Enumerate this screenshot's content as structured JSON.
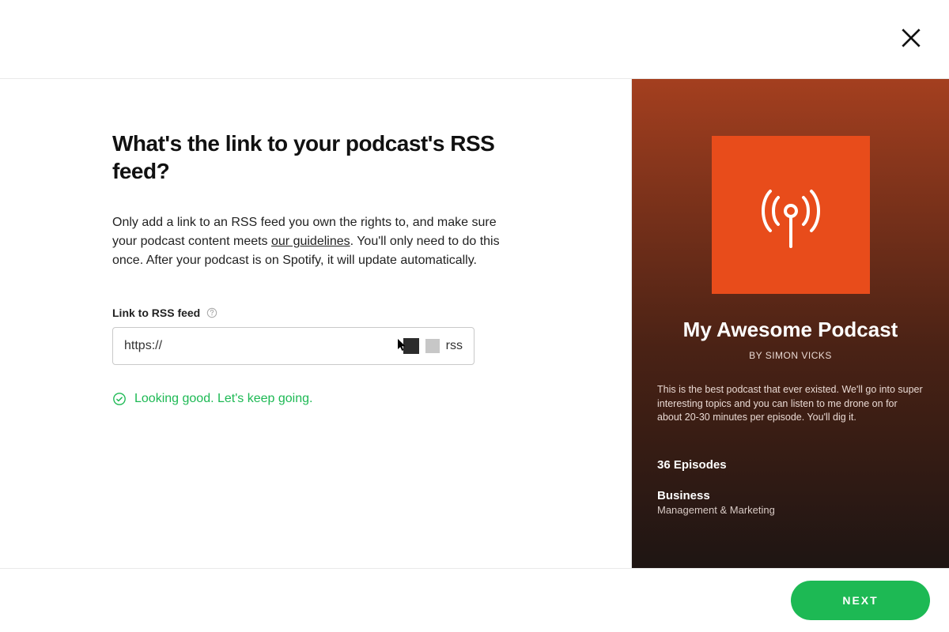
{
  "heading": "What's the link to your podcast's RSS feed?",
  "description": {
    "pre": "Only add a link to an RSS feed you own the rights to, and make sure your podcast content meets ",
    "link": "our guidelines",
    "post": ". You'll only need to do this once. After your podcast is on Spotify, it will update automatically."
  },
  "field": {
    "label": "Link to RSS feed",
    "prefix_value": "https://",
    "suffix_value": "rss"
  },
  "validation": {
    "text": "Looking good. Let's keep going."
  },
  "preview": {
    "title": "My Awesome Podcast",
    "author": "BY SIMON VICKS",
    "description": "This is the best podcast that ever existed. We'll go into super interesting topics and you can listen to me drone on for about 20-30 minutes per episode. You'll dig it.",
    "episodes": "36 Episodes",
    "category": "Business",
    "subcategory": "Management & Marketing"
  },
  "footer": {
    "next_label": "NEXT"
  },
  "colors": {
    "accent_green": "#1db954",
    "art_orange": "#e84c1b"
  }
}
